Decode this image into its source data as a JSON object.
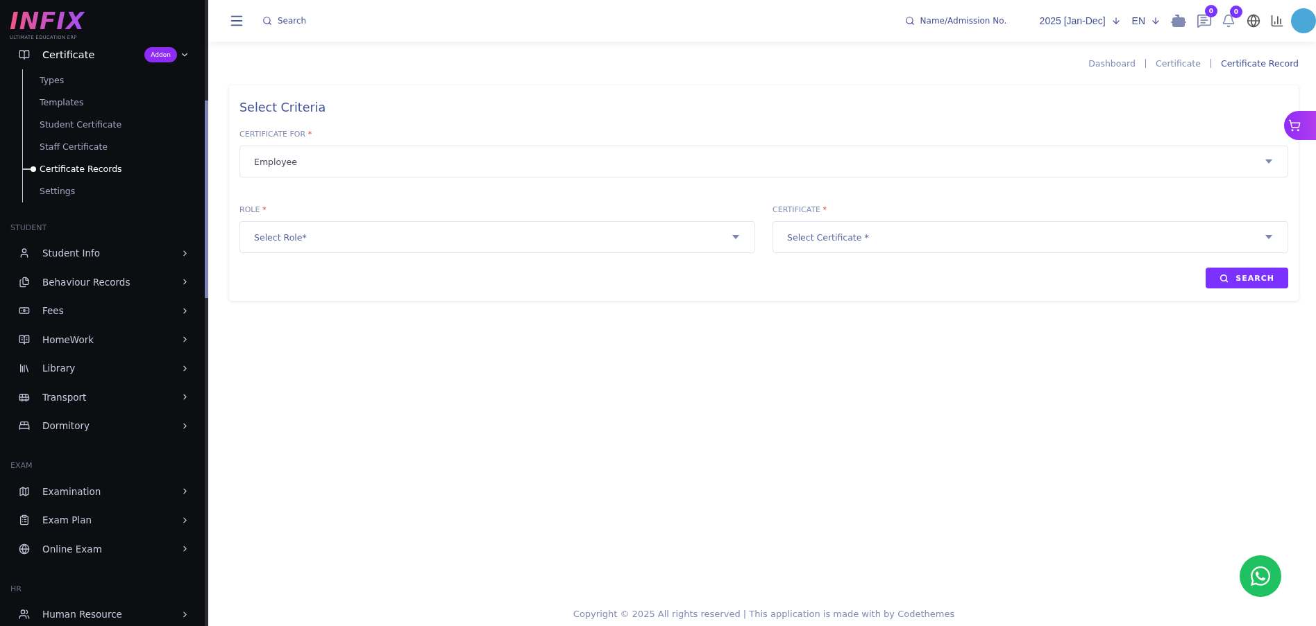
{
  "sidebar": {
    "logo": {
      "wordmark": "INFIX",
      "tagline": "ULTIMATE EDUCATION ERP"
    },
    "sections": [
      {
        "items": [
          {
            "label": "Certificate",
            "badge": "Addon",
            "expanded": true,
            "children": [
              {
                "label": "Types",
                "selected": false
              },
              {
                "label": "Templates",
                "selected": false
              },
              {
                "label": "Student Certificate",
                "selected": false
              },
              {
                "label": "Staff Certificate",
                "selected": false
              },
              {
                "label": "Certificate Records",
                "selected": true
              },
              {
                "label": "Settings",
                "selected": false
              }
            ]
          }
        ]
      },
      {
        "heading": "STUDENT",
        "items": [
          {
            "label": "Student Info",
            "expanded": false
          },
          {
            "label": "Behaviour Records",
            "expanded": false
          },
          {
            "label": "Fees",
            "expanded": false
          },
          {
            "label": "HomeWork",
            "expanded": false
          },
          {
            "label": "Library",
            "expanded": false
          },
          {
            "label": "Transport",
            "expanded": false
          },
          {
            "label": "Dormitory",
            "expanded": false
          }
        ]
      },
      {
        "heading": "EXAM",
        "items": [
          {
            "label": "Examination",
            "expanded": false
          },
          {
            "label": "Exam Plan",
            "expanded": false
          },
          {
            "label": "Online Exam",
            "expanded": false
          }
        ]
      },
      {
        "heading": "HR",
        "items": [
          {
            "label": "Human Resource",
            "expanded": false
          }
        ]
      }
    ]
  },
  "header": {
    "search": {
      "placeholder": "Search"
    },
    "student_search": {
      "placeholder": "Name/Admission No."
    },
    "session": "2025 [Jan-Dec]",
    "language": "EN",
    "messages_badge": "0",
    "notifications_badge": "0"
  },
  "breadcrumb": [
    {
      "label": "Dashboard",
      "selected": false
    },
    {
      "label": "Certificate",
      "selected": false
    },
    {
      "label": "Certificate Record",
      "selected": true
    }
  ],
  "form": {
    "title": "Select Criteria",
    "fields": [
      {
        "label": "CERTIFICATE FOR",
        "required_mark": "*",
        "value": "Employee"
      },
      {
        "label": "ROLE",
        "required_mark": "*",
        "placeholder": "Select Role*"
      },
      {
        "label": "CERTIFICATE",
        "required_mark": "*",
        "placeholder": "Select Certificate *"
      }
    ],
    "button": "SEARCH"
  },
  "footer": "Copyright © 2025 All rights reserved | This application is made with by Codethemes"
}
